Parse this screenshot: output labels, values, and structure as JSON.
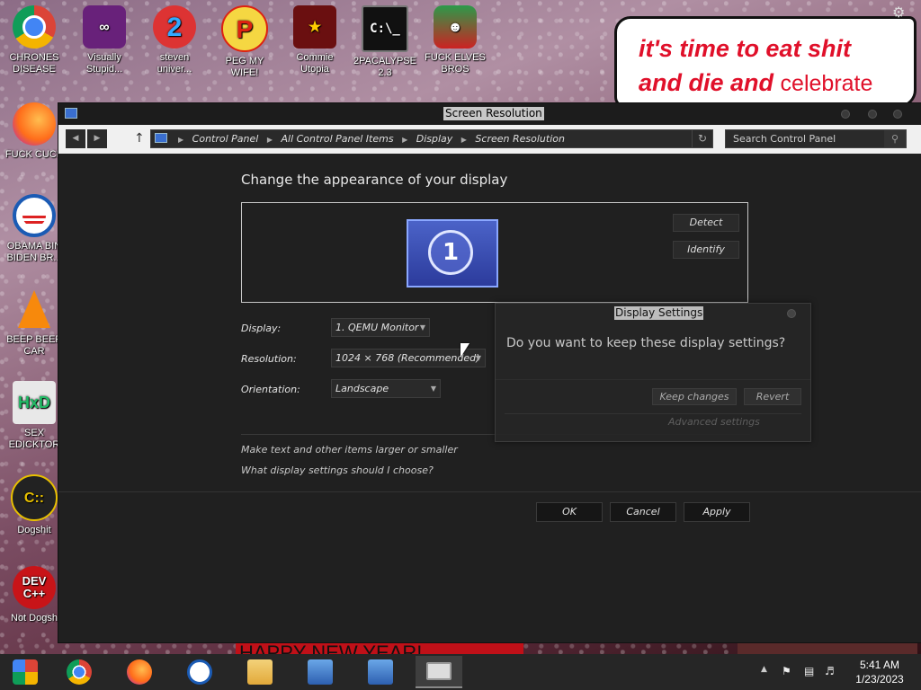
{
  "desktop": {
    "icons": [
      {
        "label": "CHRONES DISEASE",
        "icon": "chrome-icon"
      },
      {
        "label": "Visually Stupid...",
        "icon": "visual-studio-icon"
      },
      {
        "label": "steven univer...",
        "icon": "steven-universe-icon"
      },
      {
        "label": "PEG MY WIFE!",
        "icon": "p-logo-icon"
      },
      {
        "label": "Commie Utopia",
        "icon": "commie-utopia-icon"
      },
      {
        "label": "2PACALYPSE 2.3",
        "icon": "cmd-icon"
      },
      {
        "label": "FUCK ELVES BROS",
        "icon": "elf-icon"
      },
      {
        "label": "FUCK CUCK",
        "icon": "firefox-icon"
      },
      {
        "label": "OBAMA BIN BIDEN BR...",
        "icon": "obama-logo-icon"
      },
      {
        "label": "BEEP BEEP CAR",
        "icon": "vlc-icon"
      },
      {
        "label": "SEX EDICKTOR",
        "icon": "hxd-icon"
      },
      {
        "label": "Dogshit",
        "icon": "codeblocks-icon"
      },
      {
        "label": "Not Dogsh",
        "icon": "devcpp-icon"
      }
    ],
    "meme": {
      "line1": "it's time to eat shit",
      "line2": "and die and",
      "line3": "celebrate"
    },
    "banner_text": "HAPPY NEW YEAR!"
  },
  "window": {
    "title": "Screen Resolution",
    "breadcrumbs": [
      "Control Panel",
      "All Control Panel Items",
      "Display",
      "Screen Resolution"
    ],
    "search_placeholder": "Search Control Panel",
    "heading": "Change the appearance of your display",
    "monitor_number": "1",
    "detect_label": "Detect",
    "identify_label": "Identify",
    "fields": {
      "display_label": "Display:",
      "display_value": "1. QEMU Monitor",
      "resolution_label": "Resolution:",
      "resolution_value": "1024 × 768 (Recommended)",
      "orientation_label": "Orientation:",
      "orientation_value": "Landscape"
    },
    "links": {
      "text_size": "Make text and other items larger or smaller",
      "which_settings": "What display settings should I choose?"
    },
    "buttons": {
      "ok": "OK",
      "cancel": "Cancel",
      "apply": "Apply"
    }
  },
  "dialog": {
    "title": "Display Settings",
    "message": "Do you want to keep these display settings?",
    "keep_label": "Keep changes",
    "revert_label": "Revert",
    "advanced_label": "Advanced settings"
  },
  "taskbar": {
    "time": "5:41 AM",
    "date": "1/23/2023"
  }
}
